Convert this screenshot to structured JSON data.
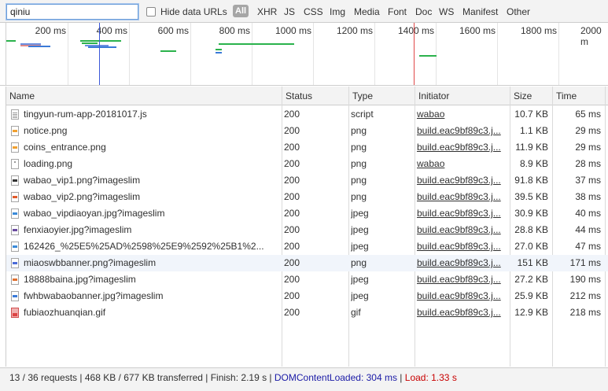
{
  "toolbar": {
    "filter_value": "qiniu",
    "hide_data_urls_label": "Hide data URLs",
    "types": [
      "All",
      "XHR",
      "JS",
      "CSS",
      "Img",
      "Media",
      "Font",
      "Doc",
      "WS",
      "Manifest",
      "Other"
    ]
  },
  "overview": {
    "ticks": [
      "200 ms",
      "400 ms",
      "600 ms",
      "800 ms",
      "1000 ms",
      "1200 ms",
      "1400 ms",
      "1600 ms",
      "1800 ms",
      "2000 m"
    ],
    "dom_content_loaded_color": "#3b57d8",
    "load_color": "#e04848"
  },
  "table": {
    "headers": {
      "name": "Name",
      "status": "Status",
      "type": "Type",
      "initiator": "Initiator",
      "size": "Size",
      "time": "Time"
    },
    "rows": [
      {
        "name": "tingyun-rum-app-20181017.js",
        "status": "200",
        "type": "script",
        "initiator": "wabao",
        "size": "10.7 KB",
        "time": "65 ms",
        "icon": "script-file-icon"
      },
      {
        "name": "notice.png",
        "status": "200",
        "type": "png",
        "initiator": "build.eac9bf89c3.j...",
        "size": "1.1 KB",
        "time": "29 ms",
        "icon": "image-file-icon",
        "icon_color": "#f0a030"
      },
      {
        "name": "coins_entrance.png",
        "status": "200",
        "type": "png",
        "initiator": "build.eac9bf89c3.j...",
        "size": "11.9 KB",
        "time": "29 ms",
        "icon": "image-file-icon",
        "icon_color": "#f0a030"
      },
      {
        "name": "loading.png",
        "status": "200",
        "type": "png",
        "initiator": "wabao",
        "size": "8.9 KB",
        "time": "28 ms",
        "icon": "image-file-icon",
        "icon_color": ""
      },
      {
        "name": "wabao_vip1.png?imageslim",
        "status": "200",
        "type": "png",
        "initiator": "build.eac9bf89c3.j...",
        "size": "91.8 KB",
        "time": "37 ms",
        "icon": "image-file-icon",
        "icon_color": "#333333"
      },
      {
        "name": "wabao_vip2.png?imageslim",
        "status": "200",
        "type": "png",
        "initiator": "build.eac9bf89c3.j...",
        "size": "39.5 KB",
        "time": "38 ms",
        "icon": "image-file-icon",
        "icon_color": "#e05a2a"
      },
      {
        "name": "wabao_vipdiaoyan.jpg?imageslim",
        "status": "200",
        "type": "jpeg",
        "initiator": "build.eac9bf89c3.j...",
        "size": "30.9 KB",
        "time": "40 ms",
        "icon": "image-file-icon",
        "icon_color": "#3a8ad8"
      },
      {
        "name": "fenxiaoyier.jpg?imageslim",
        "status": "200",
        "type": "jpeg",
        "initiator": "build.eac9bf89c3.j...",
        "size": "28.8 KB",
        "time": "44 ms",
        "icon": "image-file-icon",
        "icon_color": "#6a4aa0"
      },
      {
        "name": "162426_%25E5%25AD%2598%25E9%2592%25B1%2...",
        "status": "200",
        "type": "jpeg",
        "initiator": "build.eac9bf89c3.j...",
        "size": "27.0 KB",
        "time": "47 ms",
        "icon": "image-file-icon",
        "icon_color": "#3a8ad8"
      },
      {
        "name": "miaoswbbanner.png?imageslim",
        "status": "200",
        "type": "png",
        "initiator": "build.eac9bf89c3.j...",
        "size": "151 KB",
        "time": "171 ms",
        "icon": "image-file-icon",
        "icon_color": "#4a6ad8"
      },
      {
        "name": "18888baina.jpg?imageslim",
        "status": "200",
        "type": "jpeg",
        "initiator": "build.eac9bf89c3.j...",
        "size": "27.2 KB",
        "time": "190 ms",
        "icon": "image-file-icon",
        "icon_color": "#e07030"
      },
      {
        "name": "fwhbwabaobanner.jpg?imageslim",
        "status": "200",
        "type": "jpeg",
        "initiator": "build.eac9bf89c3.j...",
        "size": "25.9 KB",
        "time": "212 ms",
        "icon": "image-file-icon",
        "icon_color": "#3a7ad8"
      },
      {
        "name": "fubiaozhuanqian.gif",
        "status": "200",
        "type": "gif",
        "initiator": "build.eac9bf89c3.j...",
        "size": "12.9 KB",
        "time": "218 ms",
        "icon": "gif-file-icon",
        "icon_color": "#d44444"
      }
    ]
  },
  "statusbar": {
    "summary": "13 / 36 requests | 468 KB / 677 KB transferred | Finish: 2.19 s | ",
    "dcl": "DOMContentLoaded: 304 ms",
    "sep": " | ",
    "load": "Load: 1.33 s"
  }
}
